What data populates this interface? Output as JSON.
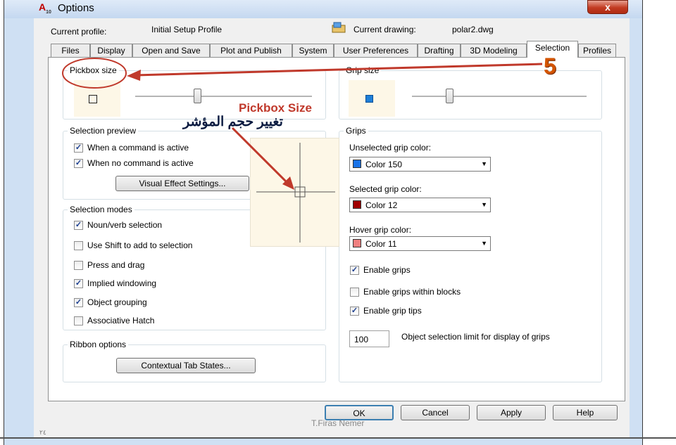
{
  "window": {
    "title": "Options",
    "close_symbol": "x"
  },
  "header": {
    "current_profile_label": "Current profile:",
    "current_profile_value": "Initial Setup Profile",
    "current_drawing_label": "Current drawing:",
    "current_drawing_value": "polar2.dwg"
  },
  "tabs": [
    {
      "label": "Files",
      "active": false
    },
    {
      "label": "Display",
      "active": false
    },
    {
      "label": "Open and Save",
      "active": false
    },
    {
      "label": "Plot and Publish",
      "active": false
    },
    {
      "label": "System",
      "active": false
    },
    {
      "label": "User Preferences",
      "active": false
    },
    {
      "label": "Drafting",
      "active": false
    },
    {
      "label": "3D Modeling",
      "active": false
    },
    {
      "label": "Selection",
      "active": true
    },
    {
      "label": "Profiles",
      "active": false
    }
  ],
  "pickbox": {
    "label": "Pickbox size",
    "slider_level": 0.3
  },
  "grip_size": {
    "label": "Grip size",
    "slider_level": 0.2,
    "preview_color": "#1e7fd8"
  },
  "selection_preview": {
    "label": "Selection preview",
    "options": [
      {
        "label": "When a command is active",
        "checked": true
      },
      {
        "label": "When no command is active",
        "checked": true
      }
    ],
    "button": "Visual Effect Settings..."
  },
  "selection_modes": {
    "label": "Selection modes",
    "options": [
      {
        "label": "Noun/verb selection",
        "checked": true
      },
      {
        "label": "Use Shift to add to selection",
        "checked": false
      },
      {
        "label": "Press and drag",
        "checked": false
      },
      {
        "label": "Implied windowing",
        "checked": true
      },
      {
        "label": "Object grouping",
        "checked": true
      },
      {
        "label": "Associative Hatch",
        "checked": false
      }
    ]
  },
  "ribbon_options": {
    "label": "Ribbon options",
    "button": "Contextual Tab States..."
  },
  "grips": {
    "label": "Grips",
    "unselected": {
      "label": "Unselected grip color:",
      "value": "Color 150",
      "swatch": "#1a73e8"
    },
    "selected": {
      "label": "Selected grip color:",
      "value": "Color 12",
      "swatch": "#a00000"
    },
    "hover": {
      "label": "Hover grip color:",
      "value": "Color 11",
      "swatch": "#f08080"
    },
    "options": [
      {
        "label": "Enable grips",
        "checked": true
      },
      {
        "label": "Enable grips within blocks",
        "checked": false
      },
      {
        "label": "Enable grip tips",
        "checked": true
      }
    ],
    "limit_value": "100",
    "limit_label": "Object selection limit for display of grips"
  },
  "footer": {
    "ok": "OK",
    "cancel": "Cancel",
    "apply": "Apply",
    "help": "Help"
  },
  "annotations": {
    "step_number": "5",
    "pickbox_title": "Pickbox Size",
    "arabic_caption": "تغيير حجم المؤشر",
    "watermark": "T.Firas Nemer",
    "page_mark": "٢٤"
  }
}
